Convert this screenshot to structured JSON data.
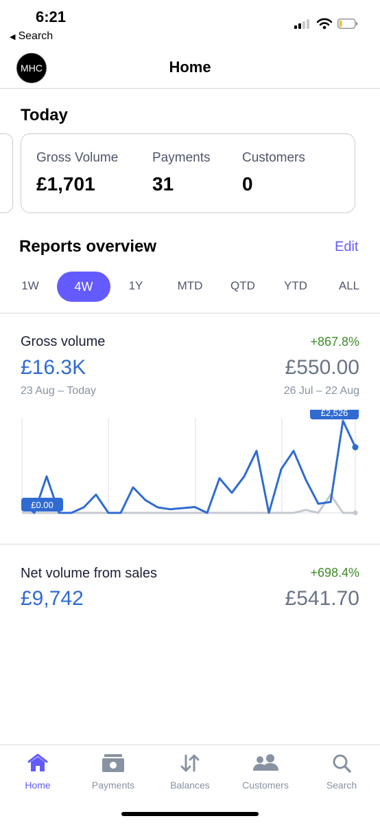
{
  "status_bar": {
    "time": "6:21",
    "back_label": "Search"
  },
  "header": {
    "avatar_text": "MHC",
    "title": "Home"
  },
  "today": {
    "heading": "Today",
    "stats": [
      {
        "label": "Gross Volume",
        "value": "£1,701"
      },
      {
        "label": "Payments",
        "value": "31"
      },
      {
        "label": "Customers",
        "value": "0"
      }
    ]
  },
  "reports": {
    "heading": "Reports overview",
    "edit_label": "Edit",
    "tabs": [
      "1W",
      "4W",
      "1Y",
      "MTD",
      "QTD",
      "YTD",
      "ALL"
    ],
    "active_tab": "4W"
  },
  "gross_volume": {
    "title": "Gross volume",
    "change": "+867.8%",
    "current": "£16.3K",
    "previous": "£550.00",
    "current_range": "23 Aug – Today",
    "previous_range": "26 Jul – 22 Aug",
    "min_tag": "£0.00",
    "max_tag": "£2,526"
  },
  "net_volume": {
    "title": "Net volume from sales",
    "change": "+698.4%",
    "current": "£9,742",
    "previous": "£541.70"
  },
  "chart_data": {
    "type": "line",
    "ylim": [
      0,
      2526
    ],
    "series": [
      {
        "values": [
          280,
          0,
          1000,
          0,
          0,
          150,
          500,
          0,
          0,
          700,
          350,
          150,
          100,
          130,
          160,
          0,
          950,
          550,
          1000,
          1700,
          0,
          1200,
          1700,
          900,
          250,
          300,
          2526,
          1800
        ]
      },
      {
        "values": [
          0,
          0,
          0,
          0,
          0,
          0,
          0,
          0,
          0,
          0,
          0,
          0,
          0,
          0,
          0,
          0,
          0,
          0,
          0,
          0,
          0,
          0,
          0,
          80,
          0,
          500,
          0,
          0
        ]
      }
    ],
    "colors": [
      "#2f6bd1",
      "#c5c9d0"
    ]
  },
  "nav": {
    "items": [
      {
        "label": "Home",
        "icon": "home-icon",
        "active": true
      },
      {
        "label": "Payments",
        "icon": "payments-icon",
        "active": false
      },
      {
        "label": "Balances",
        "icon": "balances-icon",
        "active": false
      },
      {
        "label": "Customers",
        "icon": "customers-icon",
        "active": false
      },
      {
        "label": "Search",
        "icon": "search-icon",
        "active": false
      }
    ]
  }
}
